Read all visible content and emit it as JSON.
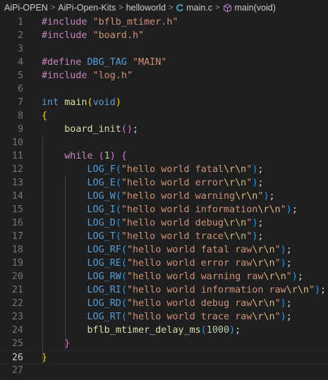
{
  "breadcrumb": {
    "items": [
      "AiPi-OPEN",
      "AiPi-Open-Kits",
      "helloworld",
      "main.c",
      "main(void)"
    ],
    "separator": ">",
    "file_icon_glyph": "C"
  },
  "editor": {
    "current_line": 26,
    "lines": [
      {
        "n": "1",
        "t": [
          [
            "#include ",
            "pp"
          ],
          [
            "\"bflb_mtimer.h\"",
            "str"
          ]
        ]
      },
      {
        "n": "2",
        "t": [
          [
            "#include ",
            "pp"
          ],
          [
            "\"board.h\"",
            "str"
          ]
        ]
      },
      {
        "n": "3",
        "t": []
      },
      {
        "n": "4",
        "t": [
          [
            "#define ",
            "pp"
          ],
          [
            "DBG_TAG",
            "mac"
          ],
          [
            " ",
            "def"
          ],
          [
            "\"MAIN\"",
            "str"
          ]
        ]
      },
      {
        "n": "5",
        "t": [
          [
            "#include ",
            "pp"
          ],
          [
            "\"log.h\"",
            "str"
          ]
        ]
      },
      {
        "n": "6",
        "t": []
      },
      {
        "n": "7",
        "t": [
          [
            "int",
            "kw"
          ],
          [
            " ",
            "def"
          ],
          [
            "main",
            "fn"
          ],
          [
            "(",
            "br1"
          ],
          [
            "void",
            "kw"
          ],
          [
            ")",
            "br1"
          ]
        ]
      },
      {
        "n": "8",
        "t": [
          [
            "{",
            "br1"
          ]
        ]
      },
      {
        "n": "9",
        "t": [
          [
            "    ",
            "def"
          ],
          [
            "board_init",
            "fn"
          ],
          [
            "()",
            "br2"
          ],
          [
            ";",
            "def"
          ]
        ]
      },
      {
        "n": "10",
        "t": []
      },
      {
        "n": "11",
        "t": [
          [
            "    ",
            "def"
          ],
          [
            "while",
            "pp"
          ],
          [
            " ",
            "def"
          ],
          [
            "(",
            "br2"
          ],
          [
            "1",
            "num"
          ],
          [
            ")",
            "br2"
          ],
          [
            " ",
            "def"
          ],
          [
            "{",
            "br2"
          ]
        ]
      },
      {
        "n": "12",
        "t": [
          [
            "        ",
            "def"
          ],
          [
            "LOG_F",
            "mac"
          ],
          [
            "(",
            "br3"
          ],
          [
            "\"hello world fatal",
            "str"
          ],
          [
            "\\r\\n",
            "esc"
          ],
          [
            "\"",
            "str"
          ],
          [
            ")",
            "br3"
          ],
          [
            ";",
            "def"
          ]
        ]
      },
      {
        "n": "13",
        "t": [
          [
            "        ",
            "def"
          ],
          [
            "LOG_E",
            "mac"
          ],
          [
            "(",
            "br3"
          ],
          [
            "\"hello world error",
            "str"
          ],
          [
            "\\r\\n",
            "esc"
          ],
          [
            "\"",
            "str"
          ],
          [
            ")",
            "br3"
          ],
          [
            ";",
            "def"
          ]
        ]
      },
      {
        "n": "14",
        "t": [
          [
            "        ",
            "def"
          ],
          [
            "LOG_W",
            "mac"
          ],
          [
            "(",
            "br3"
          ],
          [
            "\"hello world warning",
            "str"
          ],
          [
            "\\r\\n",
            "esc"
          ],
          [
            "\"",
            "str"
          ],
          [
            ")",
            "br3"
          ],
          [
            ";",
            "def"
          ]
        ]
      },
      {
        "n": "15",
        "t": [
          [
            "        ",
            "def"
          ],
          [
            "LOG_I",
            "mac"
          ],
          [
            "(",
            "br3"
          ],
          [
            "\"hello world information",
            "str"
          ],
          [
            "\\r\\n",
            "esc"
          ],
          [
            "\"",
            "str"
          ],
          [
            ")",
            "br3"
          ],
          [
            ";",
            "def"
          ]
        ]
      },
      {
        "n": "16",
        "t": [
          [
            "        ",
            "def"
          ],
          [
            "LOG_D",
            "mac"
          ],
          [
            "(",
            "br3"
          ],
          [
            "\"hello world debug",
            "str"
          ],
          [
            "\\r\\n",
            "esc"
          ],
          [
            "\"",
            "str"
          ],
          [
            ")",
            "br3"
          ],
          [
            ";",
            "def"
          ]
        ]
      },
      {
        "n": "17",
        "t": [
          [
            "        ",
            "def"
          ],
          [
            "LOG_T",
            "mac"
          ],
          [
            "(",
            "br3"
          ],
          [
            "\"hello world trace",
            "str"
          ],
          [
            "\\r\\n",
            "esc"
          ],
          [
            "\"",
            "str"
          ],
          [
            ")",
            "br3"
          ],
          [
            ";",
            "def"
          ]
        ]
      },
      {
        "n": "18",
        "t": [
          [
            "        ",
            "def"
          ],
          [
            "LOG_RF",
            "mac"
          ],
          [
            "(",
            "br3"
          ],
          [
            "\"hello world fatal raw",
            "str"
          ],
          [
            "\\r\\n",
            "esc"
          ],
          [
            "\"",
            "str"
          ],
          [
            ")",
            "br3"
          ],
          [
            ";",
            "def"
          ]
        ]
      },
      {
        "n": "19",
        "t": [
          [
            "        ",
            "def"
          ],
          [
            "LOG_RE",
            "mac"
          ],
          [
            "(",
            "br3"
          ],
          [
            "\"hello world error raw",
            "str"
          ],
          [
            "\\r\\n",
            "esc"
          ],
          [
            "\"",
            "str"
          ],
          [
            ")",
            "br3"
          ],
          [
            ";",
            "def"
          ]
        ]
      },
      {
        "n": "20",
        "t": [
          [
            "        ",
            "def"
          ],
          [
            "LOG_RW",
            "mac"
          ],
          [
            "(",
            "br3"
          ],
          [
            "\"hello world warning raw",
            "str"
          ],
          [
            "\\r\\n",
            "esc"
          ],
          [
            "\"",
            "str"
          ],
          [
            ")",
            "br3"
          ],
          [
            ";",
            "def"
          ]
        ]
      },
      {
        "n": "21",
        "t": [
          [
            "        ",
            "def"
          ],
          [
            "LOG_RI",
            "mac"
          ],
          [
            "(",
            "br3"
          ],
          [
            "\"hello world information raw",
            "str"
          ],
          [
            "\\r\\n",
            "esc"
          ],
          [
            "\"",
            "str"
          ],
          [
            ")",
            "br3"
          ],
          [
            ";",
            "def"
          ]
        ]
      },
      {
        "n": "22",
        "t": [
          [
            "        ",
            "def"
          ],
          [
            "LOG_RD",
            "mac"
          ],
          [
            "(",
            "br3"
          ],
          [
            "\"hello world debug raw",
            "str"
          ],
          [
            "\\r\\n",
            "esc"
          ],
          [
            "\"",
            "str"
          ],
          [
            ")",
            "br3"
          ],
          [
            ";",
            "def"
          ]
        ]
      },
      {
        "n": "23",
        "t": [
          [
            "        ",
            "def"
          ],
          [
            "LOG_RT",
            "mac"
          ],
          [
            "(",
            "br3"
          ],
          [
            "\"hello world trace raw",
            "str"
          ],
          [
            "\\r\\n",
            "esc"
          ],
          [
            "\"",
            "str"
          ],
          [
            ")",
            "br3"
          ],
          [
            ";",
            "def"
          ]
        ]
      },
      {
        "n": "24",
        "t": [
          [
            "        ",
            "def"
          ],
          [
            "bflb_mtimer_delay_ms",
            "fn"
          ],
          [
            "(",
            "br3"
          ],
          [
            "1000",
            "num"
          ],
          [
            ")",
            "br3"
          ],
          [
            ";",
            "def"
          ]
        ]
      },
      {
        "n": "25",
        "t": [
          [
            "    ",
            "def"
          ],
          [
            "}",
            "br2"
          ]
        ]
      },
      {
        "n": "26",
        "t": [
          [
            "}",
            "br1"
          ]
        ]
      },
      {
        "n": "27",
        "t": []
      }
    ]
  },
  "colors": {
    "background": "#1f1f1f",
    "preprocessor": "#c586c0",
    "string": "#ce9178",
    "keyword": "#569cd6",
    "function": "#dcdcaa",
    "number": "#b5cea8",
    "escape": "#d7ba7d",
    "bracket_level_1": "#ffd700",
    "bracket_level_2": "#da70d6",
    "bracket_level_3": "#179fff"
  },
  "icons": [
    "c-file-icon",
    "symbol-method-icon"
  ]
}
